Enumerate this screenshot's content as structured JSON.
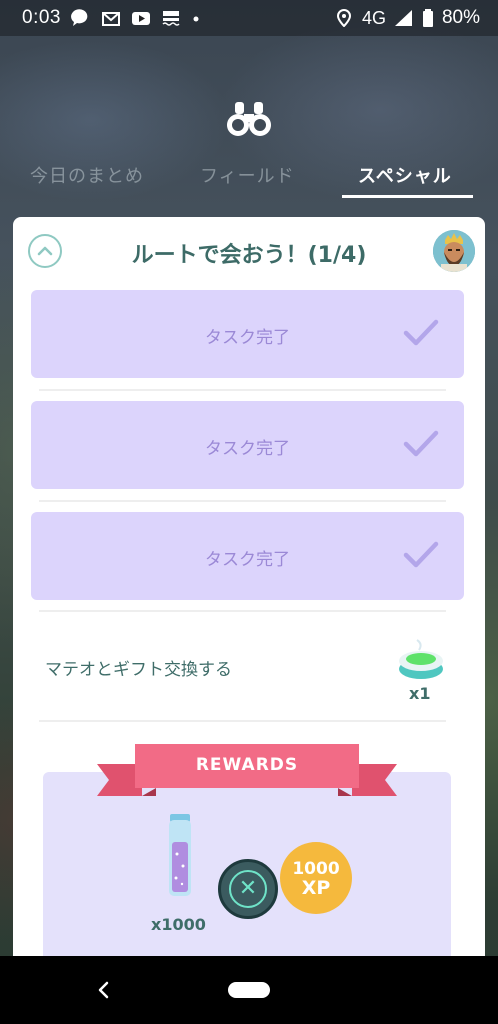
{
  "status_bar": {
    "time": "0:03",
    "network": "4G",
    "battery": "80%",
    "icons": [
      "chat-icon",
      "mail-icon",
      "youtube-icon",
      "news-icon",
      "dot-icon",
      "location-icon",
      "signal-icon",
      "battery-icon"
    ]
  },
  "header": {
    "icon": "binoculars-icon",
    "tabs": [
      {
        "label": "今日のまとめ",
        "active": false
      },
      {
        "label": "フィールド",
        "active": false
      },
      {
        "label": "スペシャル",
        "active": true
      }
    ]
  },
  "research": {
    "title": "ルートで会おう！(1/4)",
    "tasks": [
      {
        "label": "タスク完了",
        "done": true
      },
      {
        "label": "タスク完了",
        "done": true
      },
      {
        "label": "タスク完了",
        "done": true
      }
    ],
    "pending_task": {
      "label": "マテオとギフト交換する",
      "reward_icon": "incense-icon",
      "reward_qty": "x1"
    },
    "rewards": {
      "banner": "REWARDS",
      "stardust_qty": "x1000",
      "xp_amount": "1000",
      "xp_unit": "XP"
    }
  },
  "colors": {
    "task_bg": "#dcd4fc",
    "task_text": "#9b89d6",
    "title_text": "#3d6b67",
    "ribbon": "#f26b86",
    "xp_coin": "#f5b93d"
  }
}
